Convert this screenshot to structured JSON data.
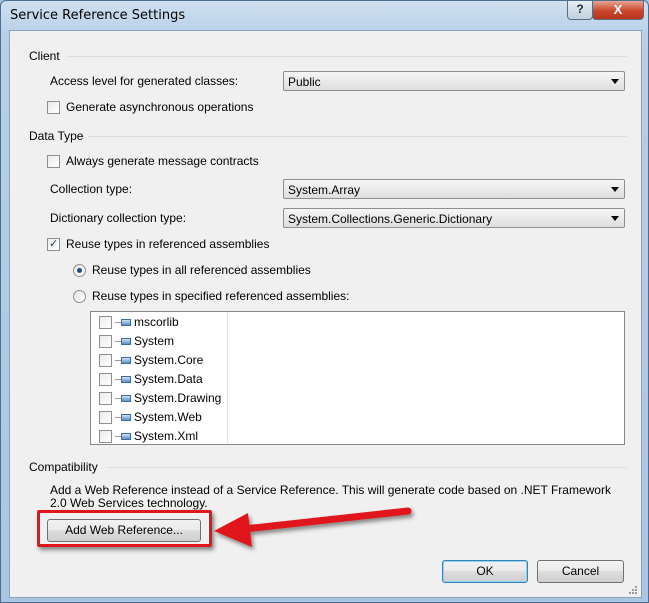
{
  "window": {
    "title": "Service Reference Settings",
    "help_label": "?",
    "close_label": "X"
  },
  "client": {
    "header": "Client",
    "access_level_label": "Access level for generated classes:",
    "access_level_value": "Public",
    "async_label": "Generate asynchronous operations",
    "async_checked": false
  },
  "datatype": {
    "header": "Data Type",
    "always_contracts_label": "Always generate message contracts",
    "always_contracts_checked": false,
    "collection_label": "Collection type:",
    "collection_value": "System.Array",
    "dictionary_label": "Dictionary collection type:",
    "dictionary_value": "System.Collections.Generic.Dictionary",
    "reuse_label": "Reuse types in referenced assemblies",
    "reuse_checked": true,
    "reuse_all_label": "Reuse types in all referenced assemblies",
    "reuse_all_selected": true,
    "reuse_specified_label": "Reuse types in specified referenced assemblies:",
    "assemblies": [
      {
        "name": "mscorlib",
        "checked": false
      },
      {
        "name": "System",
        "checked": false
      },
      {
        "name": "System.Core",
        "checked": false
      },
      {
        "name": "System.Data",
        "checked": false
      },
      {
        "name": "System.Drawing",
        "checked": false
      },
      {
        "name": "System.Web",
        "checked": false
      },
      {
        "name": "System.Xml",
        "checked": false
      }
    ]
  },
  "compat": {
    "header": "Compatibility",
    "description": "Add a Web Reference instead of a Service Reference. This will generate code based on .NET Framework 2.0 Web Services technology.",
    "add_web_ref_label": "Add Web Reference..."
  },
  "footer": {
    "ok_label": "OK",
    "cancel_label": "Cancel"
  },
  "colors": {
    "annotation_red": "#e0161b"
  }
}
